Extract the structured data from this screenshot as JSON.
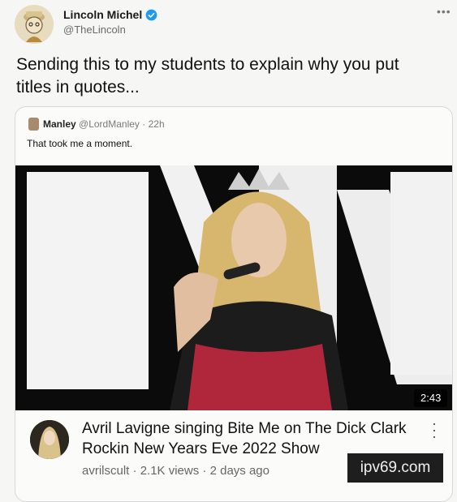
{
  "author": {
    "name": "Lincoln Michel",
    "handle": "@TheLincoln",
    "verified": true,
    "avatar": "illustrated-portrait-avatar"
  },
  "tweet": {
    "text": "Sending this to my students to explain why you put titles in quotes..."
  },
  "more_icon": "more-dots-icon",
  "quoted_tweet": {
    "author_name": "Manley",
    "handle": "@LordManley",
    "separator": "·",
    "time": "22h",
    "text": "That took me a moment."
  },
  "video": {
    "duration": "2:43",
    "channel_avatar": "channel-avatar",
    "title": "Avril Lavigne singing Bite Me on The Dick Clark Rockin New Years Eve 2022 Show",
    "channel": "avrilscult",
    "views": "2.1K views",
    "age": "2 days ago",
    "meta_separator": "·"
  },
  "watermark": "ipv69.com",
  "colors": {
    "background": "#f6f6f4",
    "verified_blue": "#1d9bf0",
    "meta_gray": "#666666"
  }
}
